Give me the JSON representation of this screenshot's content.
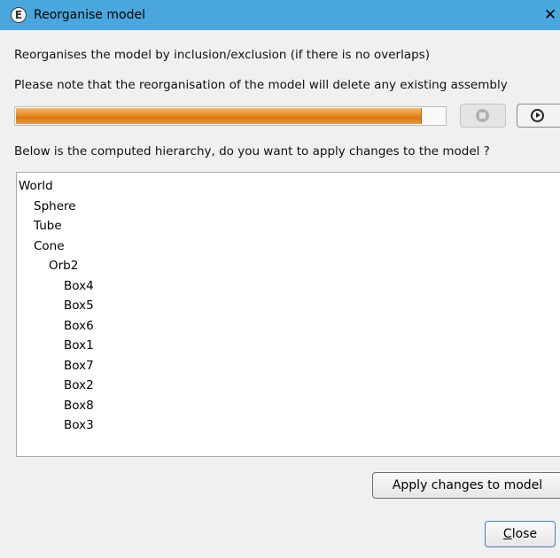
{
  "window": {
    "title": "Reorganise model",
    "app_icon_letter": "E",
    "close_glyph": "✕"
  },
  "text": {
    "description": "Reorganises the model by inclusion/exclusion (if there is no overlaps)",
    "note": "Please note that the reorganisation of the model will delete any existing assembly",
    "question": "Below is the computed hierarchy, do you want to apply changes to the model ?"
  },
  "progress": {
    "fraction": 0.945,
    "color": "#e5892a"
  },
  "toolbar": {
    "stop_icon": "stop-icon",
    "play_icon": "play-icon"
  },
  "tree": {
    "nodes": [
      {
        "label": "World",
        "level": 0
      },
      {
        "label": "Sphere",
        "level": 1
      },
      {
        "label": "Tube",
        "level": 1
      },
      {
        "label": "Cone",
        "level": 1
      },
      {
        "label": "Orb2",
        "level": 2
      },
      {
        "label": "Box4",
        "level": 3
      },
      {
        "label": "Box5",
        "level": 3
      },
      {
        "label": "Box6",
        "level": 3
      },
      {
        "label": "Box1",
        "level": 3
      },
      {
        "label": "Box7",
        "level": 3
      },
      {
        "label": "Box2",
        "level": 3
      },
      {
        "label": "Box8",
        "level": 3
      },
      {
        "label": "Box3",
        "level": 3
      }
    ]
  },
  "buttons": {
    "apply": "Apply changes to model",
    "close_mnemonic": "C",
    "close_rest": "lose"
  },
  "colors": {
    "titlebar": "#4aa7dd",
    "window_bg": "#f0f0f0"
  }
}
